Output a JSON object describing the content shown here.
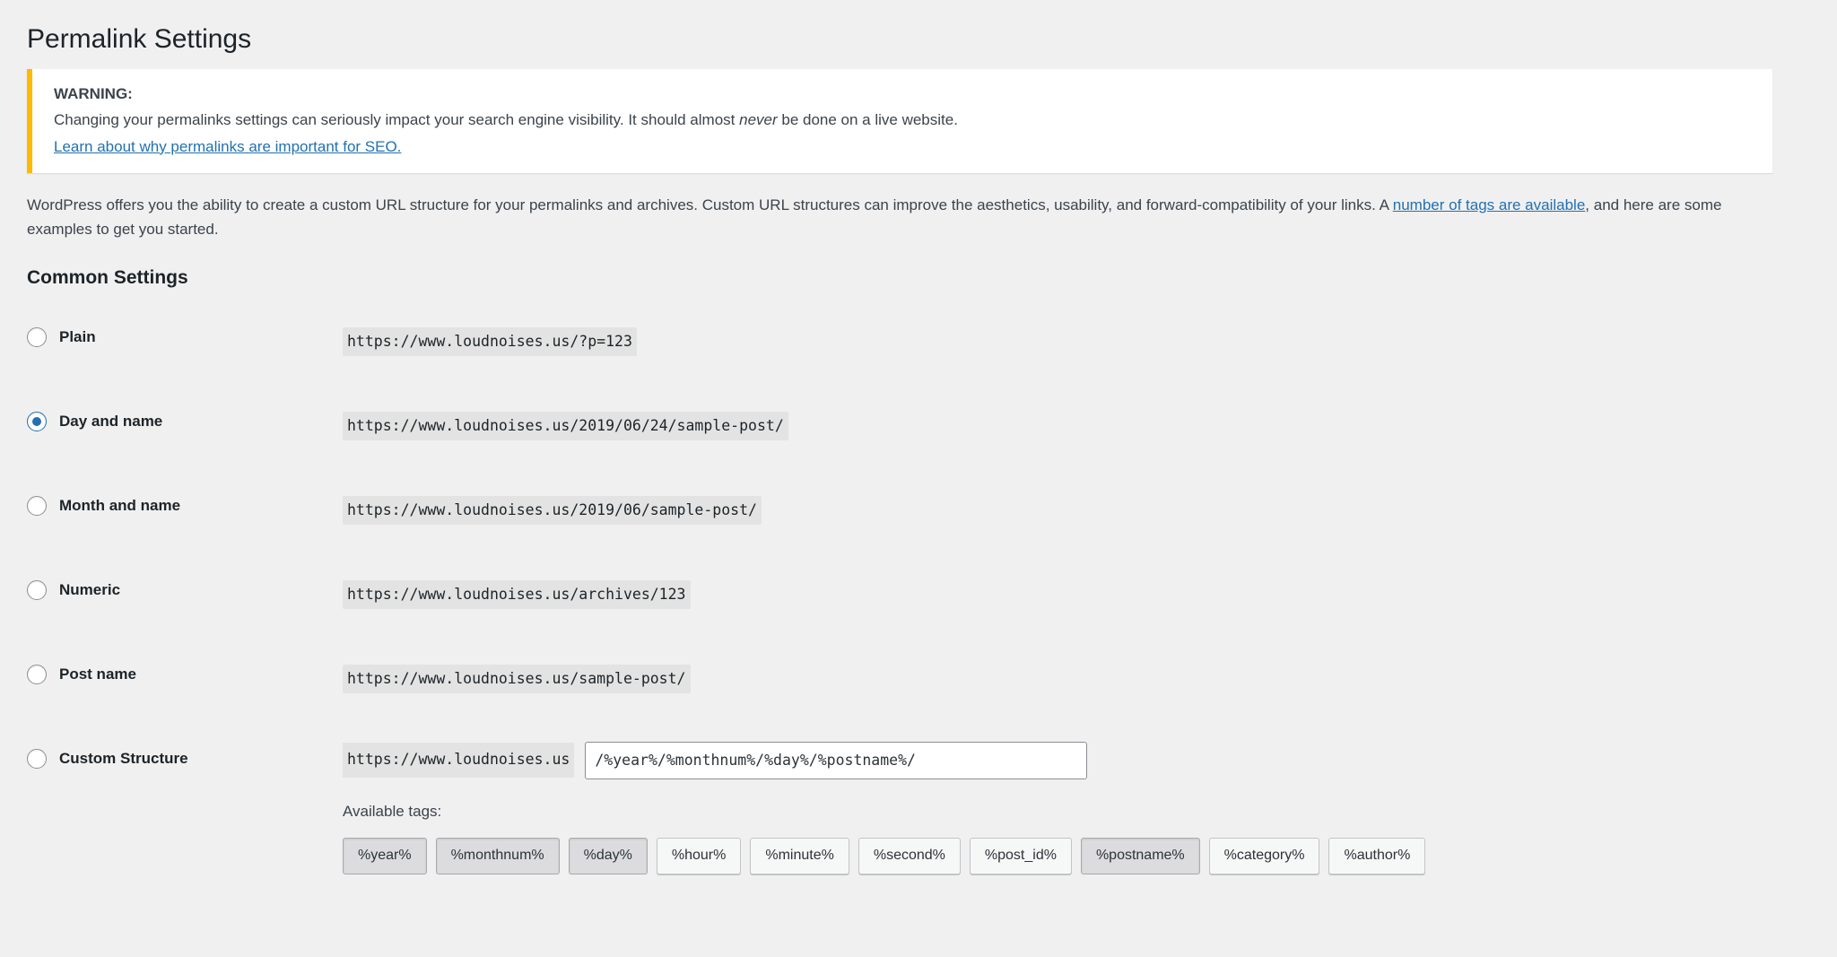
{
  "page": {
    "title": "Permalink Settings"
  },
  "notice": {
    "strong_label": "WARNING:",
    "body_before_em": "Changing your permalinks settings can seriously impact your search engine visibility. It should almost ",
    "body_em": "never",
    "body_after_em": " be done on a live website.",
    "link_text": "Learn about why permalinks are important for SEO.",
    "accent_color": "#ffb900",
    "link_color": "#2271b1"
  },
  "intro": {
    "text_before_link": "WordPress offers you the ability to create a custom URL structure for your permalinks and archives. Custom URL structures can improve the aesthetics, usability, and forward-compatibility of your links. A ",
    "link_text": "number of tags are available",
    "text_after_link": ", and here are some examples to get you started."
  },
  "common_settings": {
    "heading": "Common Settings",
    "options": [
      {
        "id": "plain",
        "label": "Plain",
        "example": "https://www.loudnoises.us/?p=123",
        "selected": false
      },
      {
        "id": "day-and-name",
        "label": "Day and name",
        "example": "https://www.loudnoises.us/2019/06/24/sample-post/",
        "selected": true
      },
      {
        "id": "month-and-name",
        "label": "Month and name",
        "example": "https://www.loudnoises.us/2019/06/sample-post/",
        "selected": false
      },
      {
        "id": "numeric",
        "label": "Numeric",
        "example": "https://www.loudnoises.us/archives/123",
        "selected": false
      },
      {
        "id": "post-name",
        "label": "Post name",
        "example": "https://www.loudnoises.us/sample-post/",
        "selected": false
      }
    ],
    "custom": {
      "label": "Custom Structure",
      "selected": false,
      "site_prefix": "https://www.loudnoises.us",
      "structure_value": "/%year%/%monthnum%/%day%/%postname%/",
      "structure_placeholder": "",
      "available_tags_label": "Available tags:",
      "tags": [
        {
          "label": "%year%",
          "active": true
        },
        {
          "label": "%monthnum%",
          "active": true
        },
        {
          "label": "%day%",
          "active": true
        },
        {
          "label": "%hour%",
          "active": false
        },
        {
          "label": "%minute%",
          "active": false
        },
        {
          "label": "%second%",
          "active": false
        },
        {
          "label": "%post_id%",
          "active": false
        },
        {
          "label": "%postname%",
          "active": true
        },
        {
          "label": "%category%",
          "active": false
        },
        {
          "label": "%author%",
          "active": false
        }
      ]
    }
  }
}
